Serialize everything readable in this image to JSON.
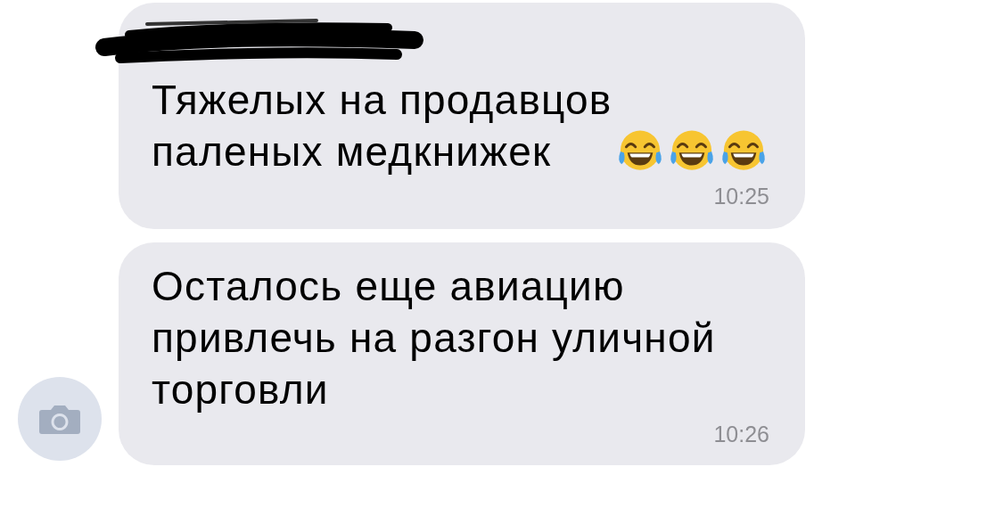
{
  "messages": [
    {
      "sender_redacted": true,
      "avatar": false,
      "text": "Тяжелых на продавцов\nпаленых медкнижек",
      "emoji": [
        {
          "kind": "tears-of-joy"
        },
        {
          "kind": "tears-of-joy"
        },
        {
          "kind": "tears-of-joy"
        }
      ],
      "time": "10:25"
    },
    {
      "sender_redacted": false,
      "avatar": true,
      "text": "Осталось еще авиацию\nпривлечь на разгон уличной\nторговли",
      "time": "10:26"
    }
  ]
}
